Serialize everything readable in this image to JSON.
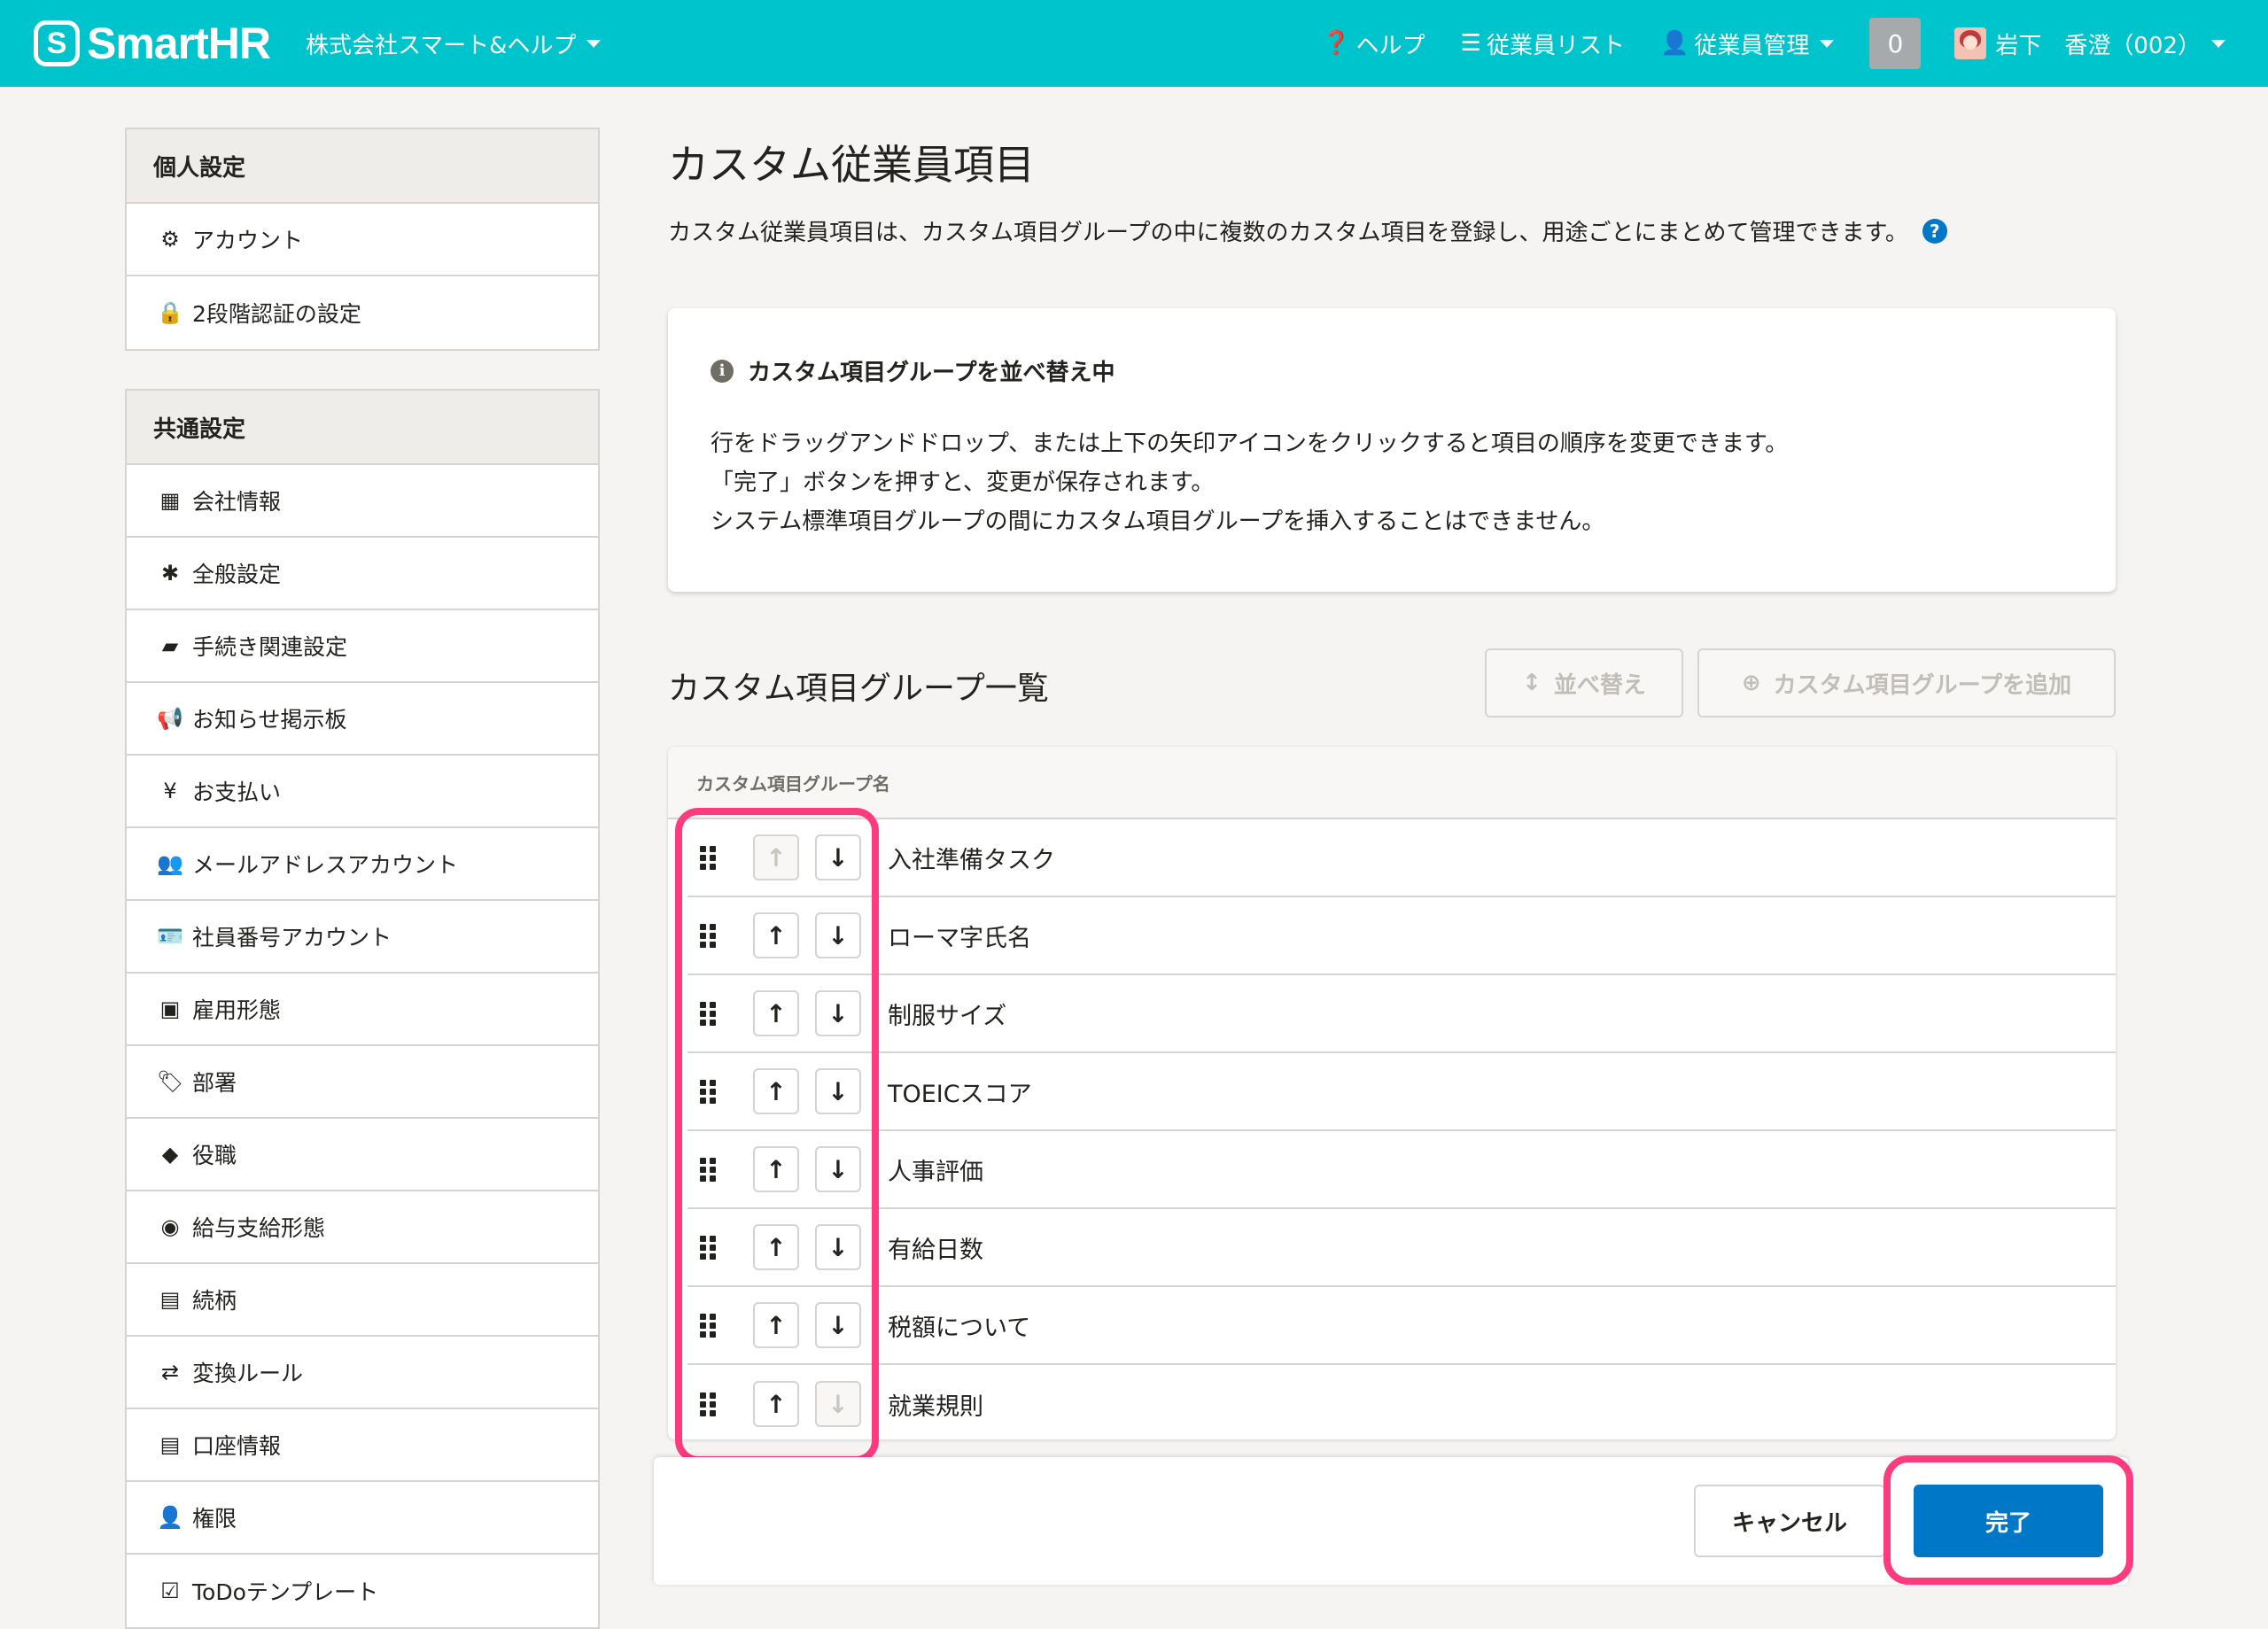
{
  "header": {
    "logo_mark": "S",
    "logo_text": "SmartHR",
    "company": "株式会社スマート&ヘルプ",
    "nav": [
      {
        "label": "ヘルプ",
        "icon": "question-circle-icon"
      },
      {
        "label": "従業員リスト",
        "icon": "list-icon"
      },
      {
        "label": "従業員管理",
        "icon": "user-icon"
      }
    ],
    "notification_count": "0",
    "user_name": "岩下　香澄（002）"
  },
  "sidebar": {
    "personal": {
      "title": "個人設定",
      "items": [
        {
          "label": "アカウント",
          "icon": "gear-icon"
        },
        {
          "label": "2段階認証の設定",
          "icon": "lock-icon"
        }
      ]
    },
    "common": {
      "title": "共通設定",
      "items": [
        {
          "label": "会社情報",
          "icon": "building-icon"
        },
        {
          "label": "全般設定",
          "icon": "asterisk-icon"
        },
        {
          "label": "手続き関連設定",
          "icon": "book-icon"
        },
        {
          "label": "お知らせ掲示板",
          "icon": "megaphone-icon"
        },
        {
          "label": "お支払い",
          "icon": "yen-icon"
        },
        {
          "label": "メールアドレスアカウント",
          "icon": "users-icon"
        },
        {
          "label": "社員番号アカウント",
          "icon": "id-card-icon"
        },
        {
          "label": "雇用形態",
          "icon": "badge-icon"
        },
        {
          "label": "部署",
          "icon": "tags-icon"
        },
        {
          "label": "役職",
          "icon": "tag-icon"
        },
        {
          "label": "給与支給形態",
          "icon": "yen-circle-icon"
        },
        {
          "label": "続柄",
          "icon": "contact-icon"
        },
        {
          "label": "変換ルール",
          "icon": "exchange-icon"
        },
        {
          "label": "口座情報",
          "icon": "list-alt-icon"
        },
        {
          "label": "権限",
          "icon": "user-key-icon"
        },
        {
          "label": "ToDoテンプレート",
          "icon": "check-square-icon"
        }
      ]
    }
  },
  "main": {
    "title": "カスタム従業員項目",
    "description": "カスタム従業員項目は、カスタム項目グループの中に複数のカスタム項目を登録し、用途ごとにまとめて管理できます。",
    "notice": {
      "title": "カスタム項目グループを並べ替え中",
      "lines": [
        "行をドラッグアンドドロップ、または上下の矢印アイコンをクリックすると項目の順序を変更できます。",
        "「完了」ボタンを押すと、変更が保存されます。",
        "システム標準項目グループの間にカスタム項目グループを挿入することはできません。"
      ]
    },
    "section_title": "カスタム項目グループ一覧",
    "sort_button": "並べ替え",
    "add_button": "カスタム項目グループを追加",
    "table_header": "カスタム項目グループ名",
    "groups": [
      "入社準備タスク",
      "ローマ字氏名",
      "制服サイズ",
      "TOEICスコア",
      "人事評価",
      "有給日数",
      "税額について",
      "就業規則"
    ],
    "cancel_button": "キャンセル",
    "done_button": "完了"
  },
  "colors": {
    "header": "#00c4cc",
    "primary": "#0077c7",
    "highlight": "#ff3b7f"
  }
}
